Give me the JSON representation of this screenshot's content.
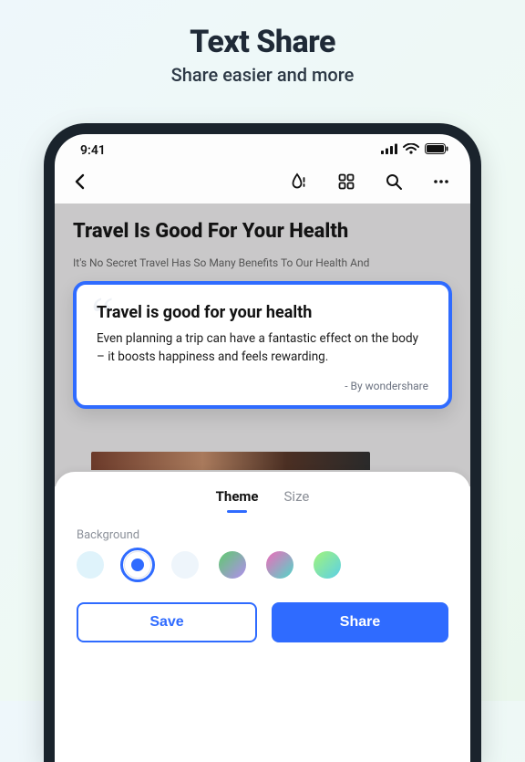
{
  "promo": {
    "title": "Text Share",
    "subtitle": "Share easier and more"
  },
  "status": {
    "time": "9:41"
  },
  "article": {
    "title": "Travel Is Good For Your Health",
    "subtitle": "It's No Secret Travel Has So Many Benefits To Our Health And"
  },
  "quote": {
    "title": "Travel is good for your health",
    "body": "Even planning a trip can have a fantastic effect on the body – it boosts happiness and feels rewarding.",
    "attribution": "- By wondershare"
  },
  "panel": {
    "tabs": {
      "theme": "Theme",
      "size": "Size",
      "active": "theme"
    },
    "section_label": "Background",
    "swatches": [
      {
        "id": "sw-lightblue",
        "selected": false
      },
      {
        "id": "sw-white",
        "selected": true
      },
      {
        "id": "sw-paleblue",
        "selected": false
      },
      {
        "id": "sw-green-purple",
        "selected": false
      },
      {
        "id": "sw-pink-teal",
        "selected": false
      },
      {
        "id": "sw-lime-cyan",
        "selected": false
      }
    ],
    "buttons": {
      "save": "Save",
      "share": "Share"
    }
  }
}
